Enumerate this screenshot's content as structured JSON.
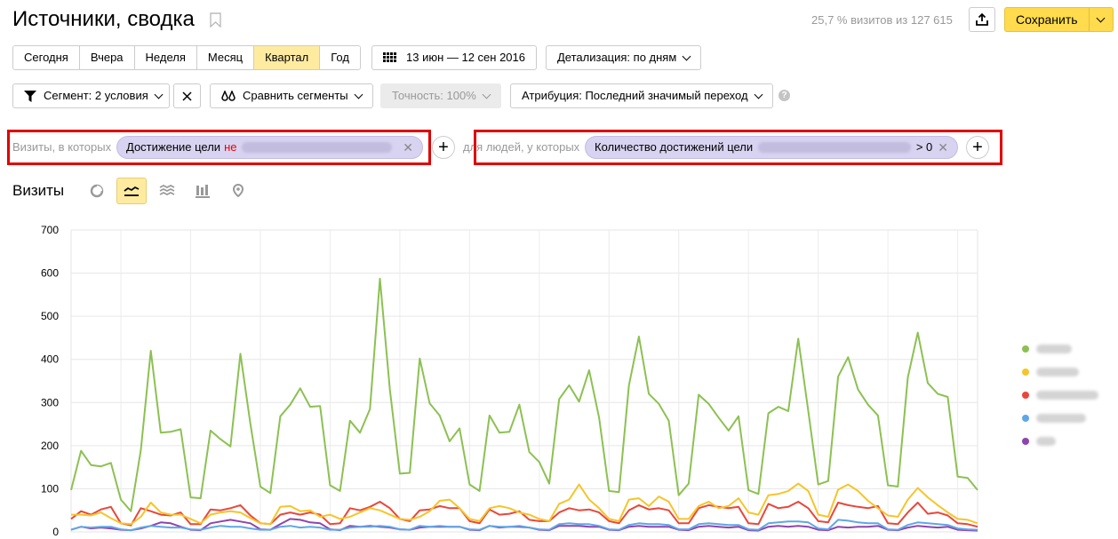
{
  "header": {
    "title": "Источники, сводка",
    "visit_count": "25,7 % визитов из 127 615",
    "save_label": "Сохранить"
  },
  "periods": [
    {
      "label": "Сегодня",
      "active": false
    },
    {
      "label": "Вчера",
      "active": false
    },
    {
      "label": "Неделя",
      "active": false
    },
    {
      "label": "Месяц",
      "active": false
    },
    {
      "label": "Квартал",
      "active": true
    },
    {
      "label": "Год",
      "active": false
    }
  ],
  "date_range": "13 июн — 12 сен 2016",
  "detail": "Детализация: по дням",
  "toolbar": {
    "segment": "Сегмент: 2 условия",
    "compare": "Сравнить сегменты",
    "accuracy": "Точность: 100%",
    "attribution": "Атрибуция: Последний значимый переход",
    "help": "?"
  },
  "segment": {
    "visits_label": "Визиты, в которых",
    "chip1_text": "Достижение цели",
    "chip1_neg": "не",
    "people_label": "для людей, у которых",
    "chip2_text": "Количество достижений цели",
    "chip2_suffix": "> 0"
  },
  "chart_section": {
    "title": "Визиты"
  },
  "icons": [
    "bookmark-icon",
    "share-icon",
    "calendar-icon",
    "filter-icon",
    "compare-icon",
    "close-icon",
    "plus-icon",
    "pie-chart-icon",
    "line-chart-icon",
    "area-chart-icon",
    "bar-chart-icon",
    "map-icon",
    "help-icon"
  ],
  "colors": {
    "accent": "#ffdb4d",
    "active_bg": "#ffeba0",
    "segment_chip": "#d7d3f0",
    "highlight_border": "#e00000"
  },
  "chart_data": {
    "type": "line",
    "ylim": [
      0,
      700
    ],
    "yticks": [
      0,
      100,
      200,
      300,
      400,
      500,
      600,
      700
    ],
    "xlabel": "",
    "ylabel": "",
    "grid": true,
    "legend": "right",
    "series": [
      {
        "color": "#8cc152",
        "values": [
          97,
          188,
          155,
          152,
          160,
          75,
          48,
          190,
          420,
          230,
          232,
          238,
          80,
          78,
          235,
          215,
          198,
          413,
          250,
          105,
          90,
          268,
          295,
          333,
          290,
          292,
          108,
          95,
          258,
          230,
          285,
          587,
          330,
          135,
          137,
          402,
          298,
          270,
          210,
          240,
          110,
          95,
          270,
          230,
          232,
          295,
          185,
          162,
          112,
          308,
          340,
          302,
          375,
          265,
          95,
          92,
          340,
          453,
          320,
          297,
          258,
          85,
          112,
          318,
          297,
          265,
          235,
          268,
          97,
          88,
          275,
          290,
          280,
          448,
          280,
          110,
          118,
          360,
          405,
          330,
          295,
          270,
          108,
          105,
          358,
          462,
          345,
          320,
          313,
          128,
          125,
          97
        ]
      },
      {
        "color": "#f5c52b",
        "values": [
          40,
          40,
          38,
          45,
          32,
          20,
          18,
          35,
          68,
          45,
          40,
          40,
          30,
          20,
          40,
          45,
          48,
          45,
          32,
          20,
          18,
          58,
          60,
          48,
          50,
          35,
          40,
          30,
          35,
          45,
          55,
          50,
          40,
          30,
          28,
          35,
          48,
          72,
          75,
          55,
          30,
          25,
          55,
          60,
          55,
          45,
          40,
          30,
          25,
          65,
          75,
          110,
          75,
          55,
          30,
          25,
          75,
          78,
          60,
          82,
          70,
          30,
          30,
          60,
          70,
          55,
          60,
          78,
          45,
          40,
          85,
          88,
          95,
          112,
          95,
          40,
          35,
          98,
          110,
          95,
          72,
          55,
          38,
          35,
          75,
          102,
          80,
          62,
          45,
          30,
          28,
          20
        ]
      },
      {
        "color": "#e9473a",
        "values": [
          30,
          48,
          40,
          52,
          58,
          20,
          15,
          55,
          48,
          40,
          38,
          45,
          18,
          18,
          52,
          50,
          55,
          62,
          38,
          20,
          18,
          40,
          45,
          40,
          45,
          40,
          18,
          20,
          55,
          50,
          58,
          70,
          55,
          30,
          25,
          50,
          52,
          60,
          55,
          55,
          25,
          20,
          52,
          40,
          42,
          48,
          28,
          25,
          25,
          45,
          55,
          50,
          52,
          45,
          25,
          20,
          50,
          62,
          52,
          55,
          50,
          20,
          20,
          55,
          62,
          58,
          55,
          58,
          20,
          18,
          65,
          55,
          58,
          70,
          55,
          25,
          22,
          68,
          62,
          58,
          55,
          60,
          20,
          18,
          45,
          68,
          42,
          45,
          38,
          20,
          18,
          12
        ]
      },
      {
        "color": "#5fa7e6",
        "values": [
          5,
          12,
          10,
          12,
          12,
          6,
          4,
          10,
          14,
          12,
          10,
          10,
          6,
          5,
          10,
          14,
          12,
          12,
          8,
          5,
          5,
          12,
          14,
          10,
          12,
          10,
          5,
          5,
          10,
          12,
          12,
          14,
          12,
          6,
          5,
          14,
          12,
          14,
          12,
          12,
          6,
          5,
          14,
          12,
          12,
          14,
          10,
          6,
          5,
          18,
          20,
          18,
          18,
          14,
          6,
          5,
          16,
          20,
          18,
          18,
          16,
          6,
          6,
          18,
          20,
          18,
          16,
          16,
          6,
          5,
          20,
          22,
          24,
          24,
          22,
          8,
          6,
          28,
          26,
          22,
          20,
          20,
          6,
          5,
          16,
          22,
          20,
          18,
          16,
          8,
          6,
          5
        ]
      },
      {
        "color": "#8e44ad",
        "values": [
          5,
          12,
          8,
          10,
          8,
          5,
          4,
          8,
          14,
          22,
          20,
          12,
          5,
          4,
          20,
          24,
          28,
          24,
          20,
          6,
          5,
          18,
          30,
          28,
          22,
          20,
          6,
          4,
          14,
          12,
          14,
          12,
          10,
          6,
          5,
          10,
          12,
          12,
          12,
          12,
          5,
          4,
          14,
          10,
          12,
          12,
          10,
          5,
          4,
          14,
          14,
          14,
          12,
          12,
          5,
          4,
          12,
          14,
          12,
          12,
          12,
          5,
          4,
          12,
          14,
          12,
          10,
          12,
          4,
          3,
          12,
          14,
          12,
          14,
          12,
          5,
          4,
          12,
          10,
          12,
          12,
          14,
          5,
          4,
          10,
          14,
          12,
          10,
          12,
          5,
          4,
          3
        ]
      }
    ]
  }
}
